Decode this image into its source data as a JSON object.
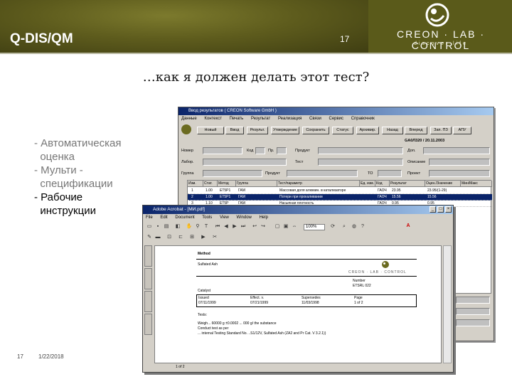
{
  "header": {
    "app_title": "Q-DIS/QM",
    "page_number": "17",
    "logo_text": "CREON · LAB · CONTROL",
    "logo_subtitle": "discover life"
  },
  "slide": {
    "title": "…как я должен делать этот тест?",
    "bullets": [
      "- Автоматическая",
      "  оценка",
      "- Мульти -",
      "  спецификации",
      "- Рабочие",
      "  инструкции"
    ]
  },
  "footer": {
    "number": "17",
    "date": "1/22/2018"
  },
  "app_window": {
    "title": "Ввод результатов ( CREON Software GmbH )",
    "menu": [
      "Данные",
      "Контекст",
      "Печать",
      "Результат",
      "Реализация",
      "Связи",
      "Сервис",
      "Справочник"
    ],
    "toolbar": [
      "Новый",
      "Ввод",
      "Результ.",
      "Утверждение",
      "Сохранить",
      "Статус",
      "Архивир.",
      "Назад",
      "Вперед",
      "Зап. ПЗ",
      "АПУ"
    ],
    "gaap_no": "GA0Л320 / 20.11.2003",
    "fields": [
      "Номер",
      "Лабор.",
      "Группа",
      "Продукт",
      "Доп.",
      "Тест",
      "Описание",
      "Проект"
    ],
    "short_labels": [
      "Код",
      "Пр.",
      "ТО"
    ],
    "grid_headers": [
      "Изм.",
      "Стат.",
      "Метод",
      "Группа",
      "Тест/параметр",
      "Ед. изм.",
      "Код",
      "Результат",
      "Оцен./Значение",
      "Мин/Макс"
    ],
    "grid_rows": [
      [
        "1",
        "1.00",
        "ЕТ5Р1",
        "ГАМ",
        "Массовая доля алюмин. в катализаторе",
        "",
        "ГАОЧ",
        "23.95",
        "23.95/(1-29)"
      ],
      [
        "2",
        "1.00",
        "ЕТ5Р1",
        "ГАМ",
        "Потери при прокаливании",
        "",
        "ГАОЧ",
        "15.56",
        "15.56"
      ],
      [
        "3",
        "1.10",
        "ЕТ5Р",
        "ГАМ",
        "Насыпная плотность",
        "",
        "ГАОЧ",
        "0.95",
        "0.95"
      ]
    ]
  },
  "pdf_window": {
    "title": "Adobe Acrobat - [МИ.pdf]",
    "menu": [
      "File",
      "Edit",
      "Document",
      "Tools",
      "View",
      "Window",
      "Help"
    ],
    "zoom": "100%",
    "page_indicator": "1 of 2",
    "document": {
      "method_label": "Method",
      "analyte": "Sulfated Ash",
      "number_label": "Number",
      "number_value": "ETSRL 022",
      "product_label": "Catalyst",
      "issued_label": "Issued",
      "issued_value": "07/11/1999",
      "effective_label": "Effect. v.",
      "effective_value": "07/21/1999",
      "supersedes_label": "Supersedes",
      "supersedes_value": "11/03/1998",
      "page_label": "Page",
      "page_value": "1 of 2",
      "tests_label": "Tests:",
      "line1": "Weigh... 60000 g ±0.0002  ... 000 g/ the substance",
      "line2": "Conduct test as per",
      "line3": "... internal Testing Standard No. ..S1/12V, Sulfated Ash (ZA2 and Pr Cat. V 3.2.1))"
    }
  },
  "colors": {
    "header_olive": "#5e5c1d",
    "titlebar_blue": "#0a246a",
    "window_gray": "#d4d0c8"
  }
}
